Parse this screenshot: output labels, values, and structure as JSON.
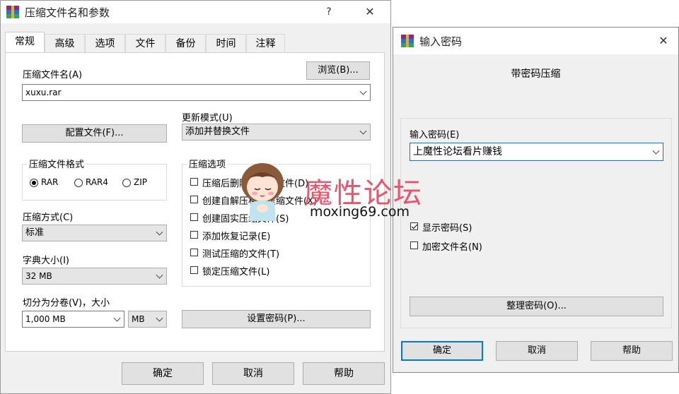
{
  "main_dialog": {
    "title": "压缩文件名和参数",
    "help_glyph": "?",
    "close_glyph": "✕",
    "tabs": [
      "常规",
      "高级",
      "选项",
      "文件",
      "备份",
      "时间",
      "注释"
    ],
    "archive_name_label": "压缩文件名(A)",
    "browse_button": "浏览(B)...",
    "archive_name_value": "xuxu.rar",
    "update_mode_label": "更新模式(U)",
    "update_mode_value": "添加并替换文件",
    "profiles_button": "配置文件(F)...",
    "format_group_label": "压缩文件格式",
    "formats": [
      "RAR",
      "RAR4",
      "ZIP"
    ],
    "selected_format": "RAR",
    "options_group_label": "压缩选项",
    "options": [
      "压缩后删除原来的文件(D)",
      "创建自解压格式压缩文件(X)",
      "创建固实压缩文件(S)",
      "添加恢复记录(E)",
      "测试压缩的文件(T)",
      "锁定压缩文件(L)"
    ],
    "method_label": "压缩方式(C)",
    "method_value": "标准",
    "dict_label": "字典大小(I)",
    "dict_value": "32 MB",
    "split_label": "切分为分卷(V)，大小",
    "split_value": "1,000 MB",
    "split_unit": "MB",
    "set_password_button": "设置密码(P)...",
    "ok_button": "确定",
    "cancel_button": "取消",
    "help_button": "帮助"
  },
  "password_dialog": {
    "title": "输入密码",
    "close_glyph": "✕",
    "subtitle": "带密码压缩",
    "password_label": "输入密码(E)",
    "password_value": "上魔性论坛看片赚钱",
    "show_password_label": "显示密码(S)",
    "show_password_checked": true,
    "encrypt_names_label": "加密文件名(N)",
    "encrypt_names_checked": false,
    "organize_button": "整理密码(O)...",
    "ok_button": "确定",
    "cancel_button": "取消",
    "help_button": "帮助"
  },
  "watermark": {
    "text": "魔性论坛",
    "url": "moxing69.com",
    "color": "#e8556a"
  }
}
